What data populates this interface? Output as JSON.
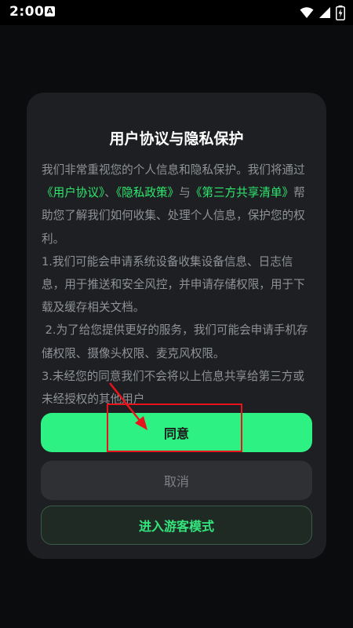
{
  "status_bar": {
    "time": "2:00",
    "notification_icon": "a-badge-icon",
    "icons": [
      "wifi-icon",
      "signal-icon",
      "battery-charging-icon"
    ]
  },
  "dialog": {
    "title": "用户协议与隐私保护",
    "intro": {
      "text_1": "我们非常重视您的个人信息和隐私保护。我们将通过",
      "link_1": "《用户协议》",
      "sep_1": "、",
      "link_2": "《隐私政策》",
      "sep_2": "与",
      "link_3": "《第三方共享清单》",
      "text_2": "帮助您了解我们如何收集、处理个人信息，保护您的权利。"
    },
    "items": [
      "1.我们可能会申请系统设备收集设备信息、日志信息，用于推送和安全风控，并申请存储权限，用于下载及缓存相关文档。",
      " 2.为了给您提供更好的服务，我们可能会申请手机存储权限、摄像头权限、麦克风权限。",
      "3.未经您的同意我们不会将以上信息共享给第三方或未经授权的其他用户"
    ],
    "buttons": {
      "agree": "同意",
      "cancel": "取消",
      "guest": "进入游客模式"
    }
  },
  "colors": {
    "accent": "#2ef184",
    "link": "#2ee86f",
    "annotation": "#e8141b"
  }
}
